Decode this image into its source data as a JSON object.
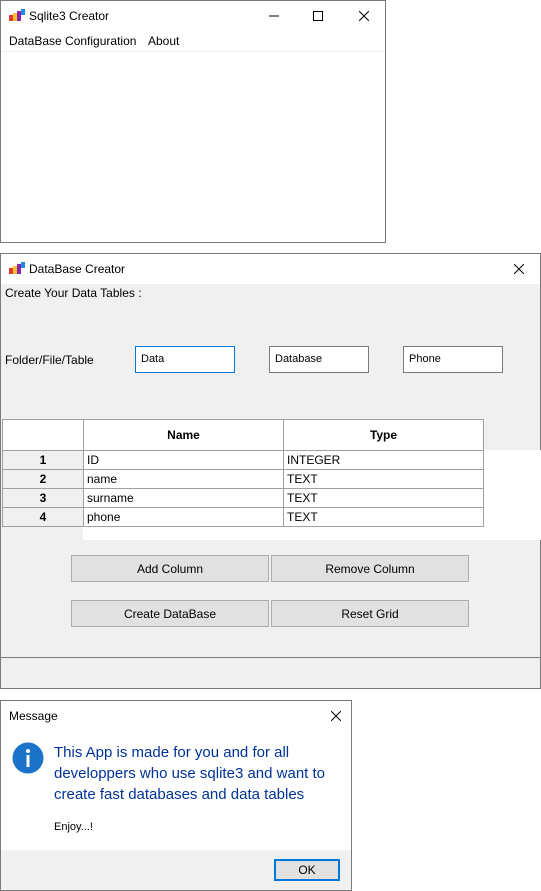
{
  "main_window": {
    "title": "Sqlite3 Creator",
    "menu": [
      "DataBase Configuration",
      "About"
    ]
  },
  "creator_window": {
    "title": "DataBase Creator",
    "heading": "Create Your Data Tables :",
    "folder_label": "Folder/File/Table",
    "inputs": {
      "folder": "Data",
      "file": "Database",
      "table": "Phone"
    },
    "grid": {
      "columns": [
        "Name",
        "Type"
      ],
      "rows": [
        {
          "num": "1",
          "name": "ID",
          "type": "INTEGER"
        },
        {
          "num": "2",
          "name": "name",
          "type": "TEXT"
        },
        {
          "num": "3",
          "name": "surname",
          "type": "TEXT"
        },
        {
          "num": "4",
          "name": "phone",
          "type": "TEXT"
        }
      ]
    },
    "buttons": {
      "add_column": "Add Column",
      "remove_column": "Remove Column",
      "create_database": "Create DataBase",
      "reset_grid": "Reset Grid"
    }
  },
  "message_box": {
    "title": "Message",
    "text": "This App is made for you and for all developpers who use sqlite3 and want to create fast databases and data tables",
    "subtext": "Enjoy...!",
    "ok_label": "OK",
    "icon": "info-icon"
  },
  "colors": {
    "accent": "#0078d7",
    "message_text": "#003399",
    "client_bg": "#f0f0f0",
    "button_bg": "#e1e1e1"
  }
}
